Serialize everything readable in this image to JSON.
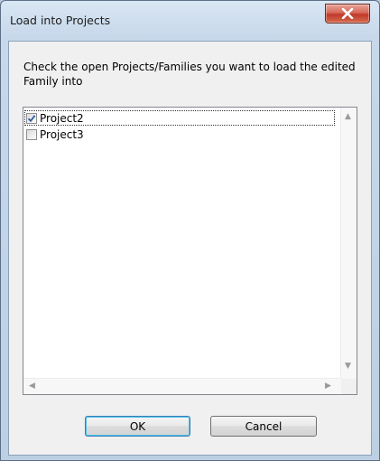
{
  "dialog": {
    "title": "Load into Projects",
    "instruction": "Check the open Projects/Families you want to load the edited Family into"
  },
  "projects": [
    {
      "label": "Project2",
      "checked": true,
      "focused": true
    },
    {
      "label": "Project3",
      "checked": false,
      "focused": false
    }
  ],
  "buttons": {
    "ok_label": "OK",
    "cancel_label": "Cancel"
  },
  "colors": {
    "close_button": "#c0392b",
    "default_button_glow": "#48c0ec",
    "check_mark": "#2a5e9f"
  }
}
